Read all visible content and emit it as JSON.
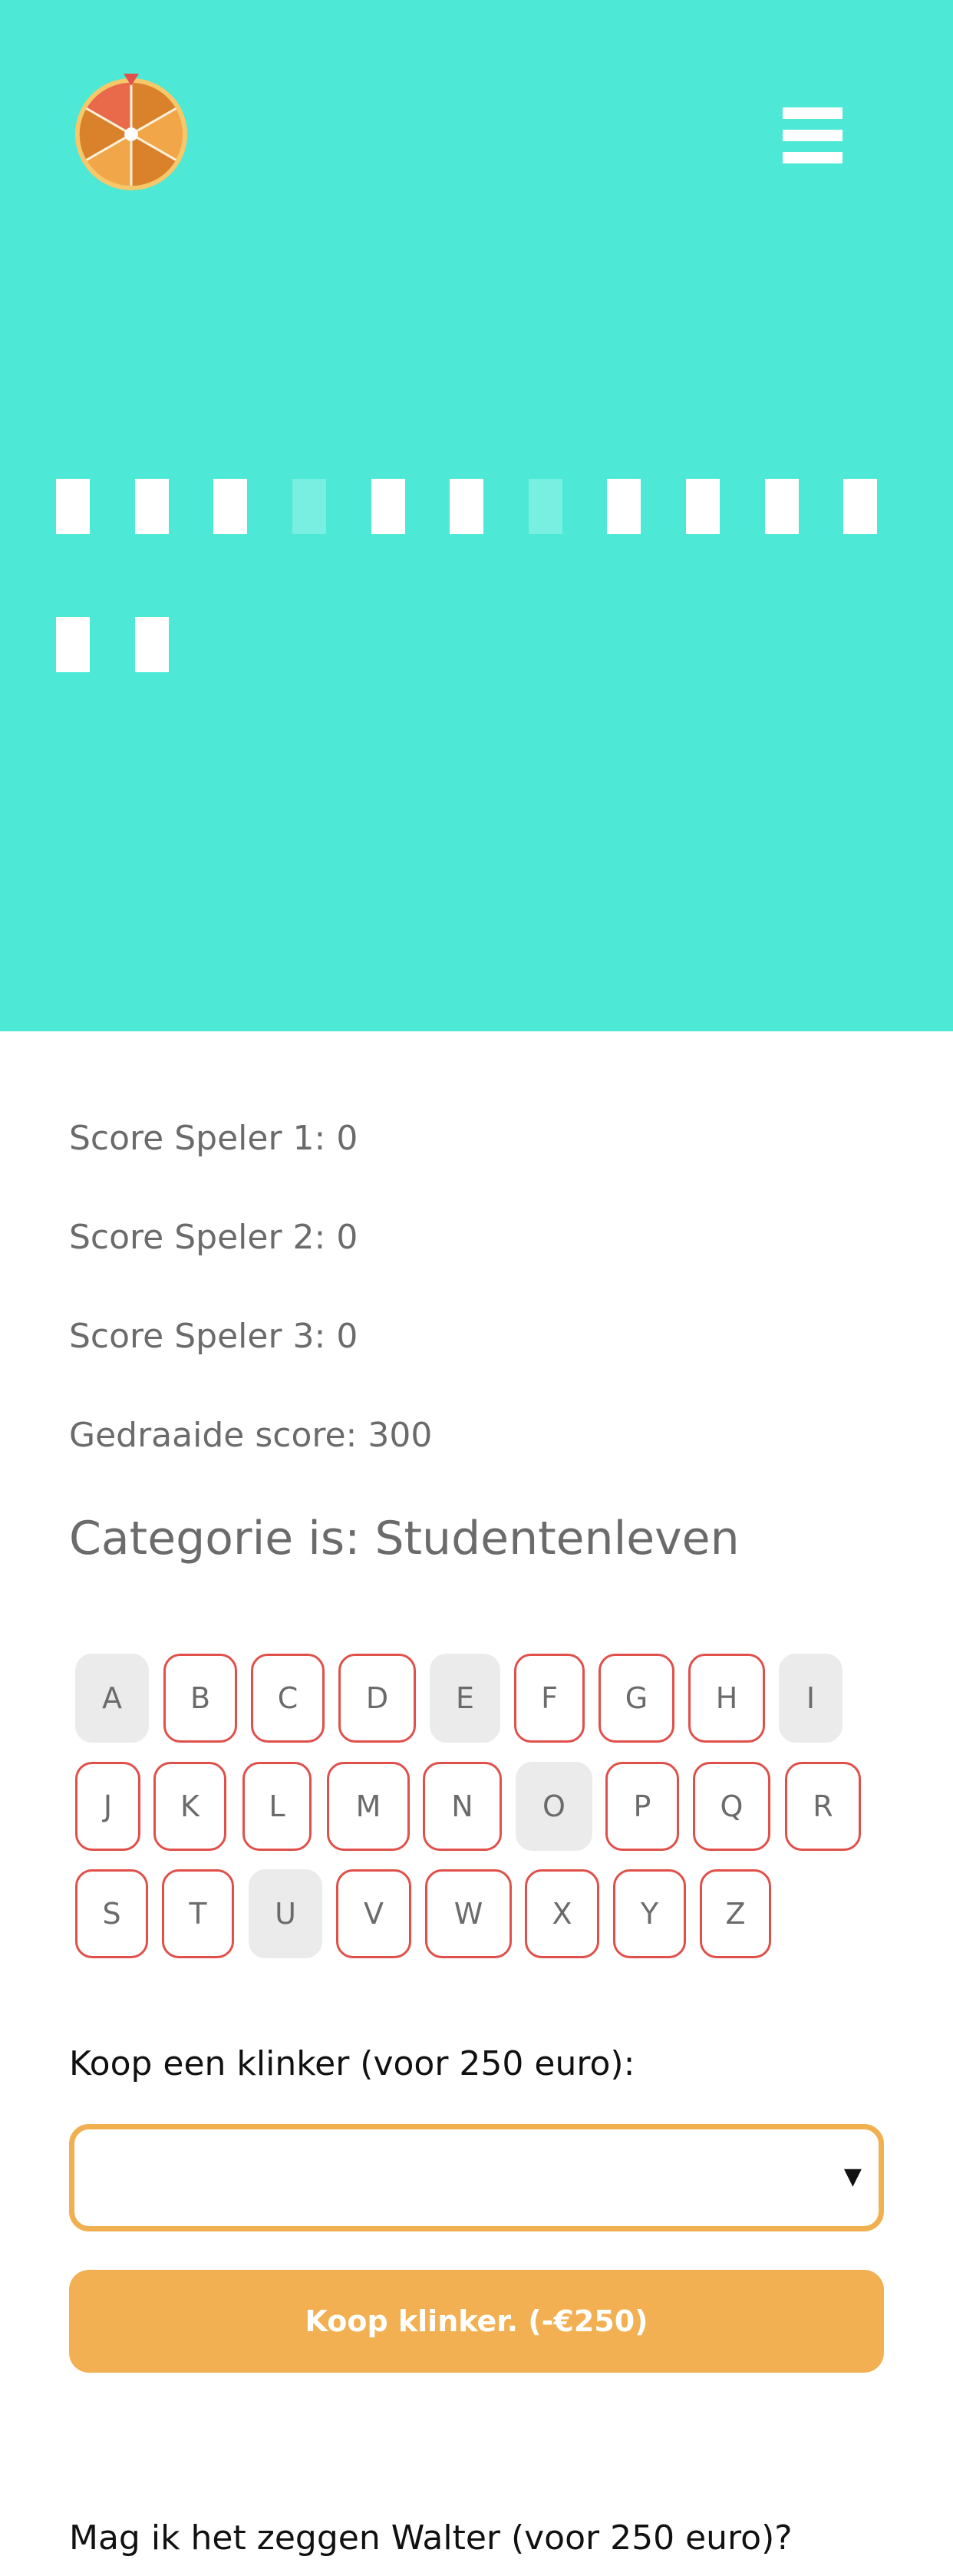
{
  "header": {
    "logo_icon": "wheel-of-fortune-icon",
    "menu_icon": "hamburger-menu-icon"
  },
  "puzzle": {
    "tiles": [
      "hidden",
      "hidden",
      "hidden",
      "space",
      "hidden",
      "hidden",
      "space",
      "hidden",
      "hidden",
      "hidden",
      "hidden",
      "hidden",
      "hidden"
    ]
  },
  "scores": {
    "player1": "Score Speler 1: 0",
    "player2": "Score Speler 2: 0",
    "player3": "Score Speler 3: 0",
    "spun": "Gedraaide score: 300"
  },
  "category": "Categorie is: Studentenleven",
  "keyboard": {
    "row1": [
      {
        "letter": "A",
        "used": true
      },
      {
        "letter": "B",
        "used": false
      },
      {
        "letter": "C",
        "used": false
      },
      {
        "letter": "D",
        "used": false
      },
      {
        "letter": "E",
        "used": true
      },
      {
        "letter": "F",
        "used": false
      },
      {
        "letter": "G",
        "used": false
      },
      {
        "letter": "H",
        "used": false
      },
      {
        "letter": "I",
        "used": true
      }
    ],
    "row2": [
      {
        "letter": "J",
        "used": false
      },
      {
        "letter": "K",
        "used": false
      },
      {
        "letter": "L",
        "used": false
      },
      {
        "letter": "M",
        "used": false
      },
      {
        "letter": "N",
        "used": false
      },
      {
        "letter": "O",
        "used": true
      },
      {
        "letter": "P",
        "used": false
      },
      {
        "letter": "Q",
        "used": false
      },
      {
        "letter": "R",
        "used": false
      }
    ],
    "row3": [
      {
        "letter": "S",
        "used": false
      },
      {
        "letter": "T",
        "used": false
      },
      {
        "letter": "U",
        "used": true
      },
      {
        "letter": "V",
        "used": false
      },
      {
        "letter": "W",
        "used": false
      },
      {
        "letter": "X",
        "used": false
      },
      {
        "letter": "Y",
        "used": false
      },
      {
        "letter": "Z",
        "used": false
      }
    ]
  },
  "vowel": {
    "label": "Koop een klinker (voor 250 euro):",
    "selected": "",
    "arrow": "▼",
    "button": "Koop klinker. (-€250)"
  },
  "guess": {
    "label": "Mag ik het zeggen Walter (voor 250 euro)?"
  },
  "colors": {
    "hero": "#4de8d6",
    "accent": "#f2b052",
    "key_border": "#e0504a",
    "key_used": "#ebebeb"
  }
}
